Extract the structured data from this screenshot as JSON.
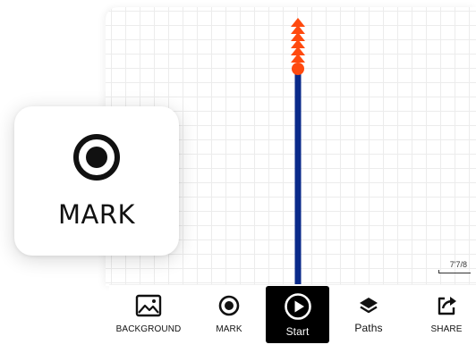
{
  "toolbar": {
    "items": [
      {
        "label": "BACKGROUND",
        "icon": "image-icon"
      },
      {
        "label": "MARK",
        "icon": "mark-target-icon"
      },
      {
        "label": "Start",
        "icon": "play-icon",
        "active": true
      },
      {
        "label": "Paths",
        "icon": "layers-icon"
      },
      {
        "label": "SHARE",
        "icon": "share-icon"
      }
    ]
  },
  "callout": {
    "label": "MARK",
    "icon": "mark-target-icon"
  },
  "canvas": {
    "scale_label": "7'7/8",
    "path_color": "#0a2a8a",
    "marker_color": "#ff4a0f"
  }
}
